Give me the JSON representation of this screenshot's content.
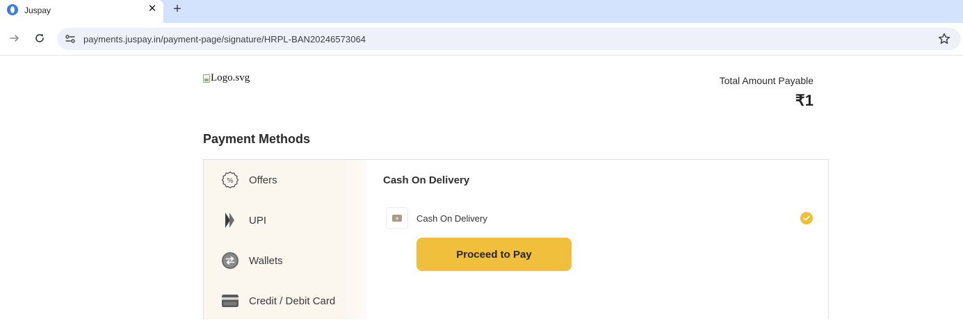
{
  "browser": {
    "tab": {
      "title": "Juspay",
      "favicon": "juspay-favicon"
    },
    "new_tab_label": "+",
    "close_label": "✕",
    "address_bar": {
      "url": "payments.juspay.in/payment-page/signature/HRPL-BAN20246573064"
    }
  },
  "header": {
    "logo_alt": "Logo.svg",
    "total_label": "Total Amount Payable",
    "total_amount": "₹1"
  },
  "payment": {
    "section_title": "Payment Methods",
    "methods": [
      {
        "label": "Offers",
        "icon": "percent-badge-icon"
      },
      {
        "label": "UPI",
        "icon": "upi-icon"
      },
      {
        "label": "Wallets",
        "icon": "wallet-exchange-icon"
      },
      {
        "label": "Credit / Debit Card",
        "icon": "card-icon"
      }
    ],
    "selected_section_title": "Cash On Delivery",
    "option": {
      "label": "Cash On Delivery",
      "icon": "cash-icon",
      "selected": true
    },
    "proceed_label": "Proceed to Pay"
  },
  "colors": {
    "accent": "#f0bf3c",
    "sidebar_bg": "#fbf6ee",
    "tabstrip_bg": "#d3e3fd"
  }
}
